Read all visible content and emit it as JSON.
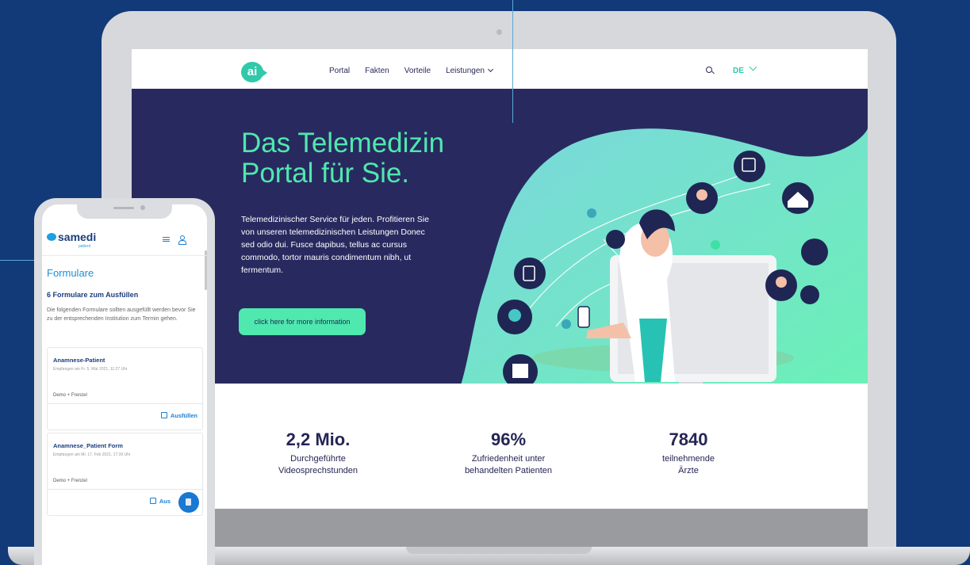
{
  "site": {
    "logo_text": "ai",
    "nav": [
      "Portal",
      "Fakten",
      "Vorteile",
      "Leistungen"
    ],
    "language": "DE",
    "hero_title": "Das Telemedizin Portal für Sie.",
    "hero_text": "Telemedizinischer Service für jeden. Profitieren Sie von unseren telemedizinischen Leistungen Donec sed odio dui. Fusce dapibus, tellus ac cursus commodo, tortor mauris condimentum nibh, ut fermentum.",
    "cta_label": "click here for more information",
    "stats": [
      {
        "value": "2,2 Mio.",
        "label_line1": "Durchgeführte",
        "label_line2": "Videosprechstunden"
      },
      {
        "value": "96%",
        "label_line1": "Zufriedenheit unter",
        "label_line2": "behandelten Patienten"
      },
      {
        "value": "7840",
        "label_line1": "teilnehmende",
        "label_line2": "Ärzte"
      }
    ],
    "colors": {
      "navy": "#282a5f",
      "mint": "#4fe8ae",
      "teal": "#30c9a9"
    }
  },
  "phone": {
    "brand": "samedi",
    "brand_sub": "patient",
    "page_title": "Formulare",
    "count_heading": "6 Formulare zum Ausfüllen",
    "description": "Die folgenden Formulare sollten ausgefüllt werden bevor Sie zu der entsprechenden Institution zum Termin gehen.",
    "forms": [
      {
        "title": "Anamnese-Patient",
        "received": "Empfangen am Fr. 5. Mär 2021, 11:27 Uhr",
        "org": "Demo + Frenzel",
        "action": "Ausfüllen"
      },
      {
        "title": "Anamnese_Patient Form",
        "received": "Empfangen am Mi. 17. Feb 2021, 17:39 Uhr",
        "org": "Demo + Frenzel",
        "action": "Aus"
      }
    ]
  }
}
